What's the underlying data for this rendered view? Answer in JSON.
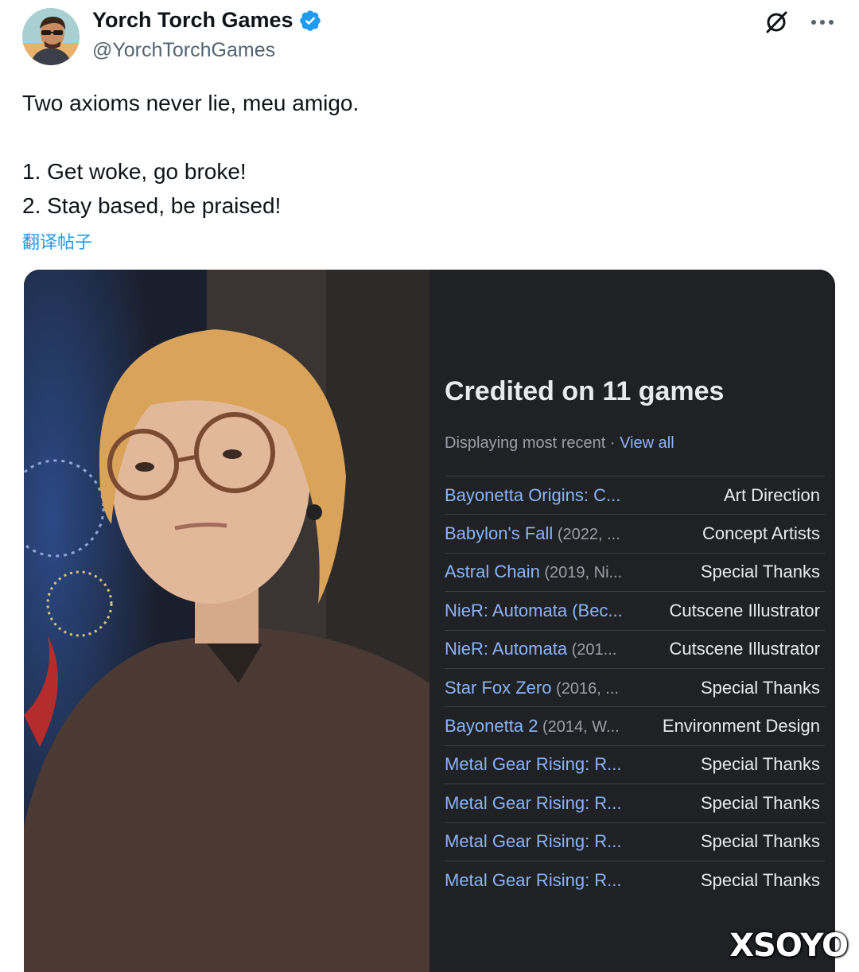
{
  "author": {
    "name": "Yorch Torch Games",
    "handle": "@YorchTorchGames"
  },
  "icons": {
    "verified": "verified-badge-icon",
    "grok": "grok-icon",
    "more": "more-icon"
  },
  "tweet": {
    "text": "Two axioms never lie, meu amigo.\n\n1. Get woke, go broke!\n2. Stay based, be praised!",
    "translate_label": "翻译帖子"
  },
  "credits_panel": {
    "title": "Credited on 11 games",
    "subtitle": "Displaying most recent",
    "separator": " · ",
    "view_all": "View all",
    "rows": [
      {
        "game": "Bayonetta Origins: C...",
        "meta": "",
        "role": "Art Direction"
      },
      {
        "game": "Babylon's Fall",
        "meta": " (2022, ...",
        "role": "Concept Artists"
      },
      {
        "game": "Astral Chain",
        "meta": " (2019, Ni...",
        "role": "Special Thanks"
      },
      {
        "game": "NieR: Automata (Bec...",
        "meta": "",
        "role": "Cutscene Illustrator"
      },
      {
        "game": "NieR: Automata",
        "meta": " (201...",
        "role": "Cutscene Illustrator"
      },
      {
        "game": "Star Fox Zero",
        "meta": " (2016, ...",
        "role": "Special Thanks"
      },
      {
        "game": "Bayonetta 2",
        "meta": " (2014, W...",
        "role": "Environment Design"
      },
      {
        "game": "Metal Gear Rising: R...",
        "meta": "",
        "role": "Special Thanks"
      },
      {
        "game": "Metal Gear Rising: R...",
        "meta": "",
        "role": "Special Thanks"
      },
      {
        "game": "Metal Gear Rising: R...",
        "meta": "",
        "role": "Special Thanks"
      },
      {
        "game": "Metal Gear Rising: R...",
        "meta": "",
        "role": "Special Thanks"
      }
    ]
  },
  "watermark": "XSOYO",
  "colors": {
    "link": "#1d9bf0",
    "panel_bg": "#202124",
    "panel_link": "#8ab4f8",
    "verified": "#1d9bf0"
  }
}
